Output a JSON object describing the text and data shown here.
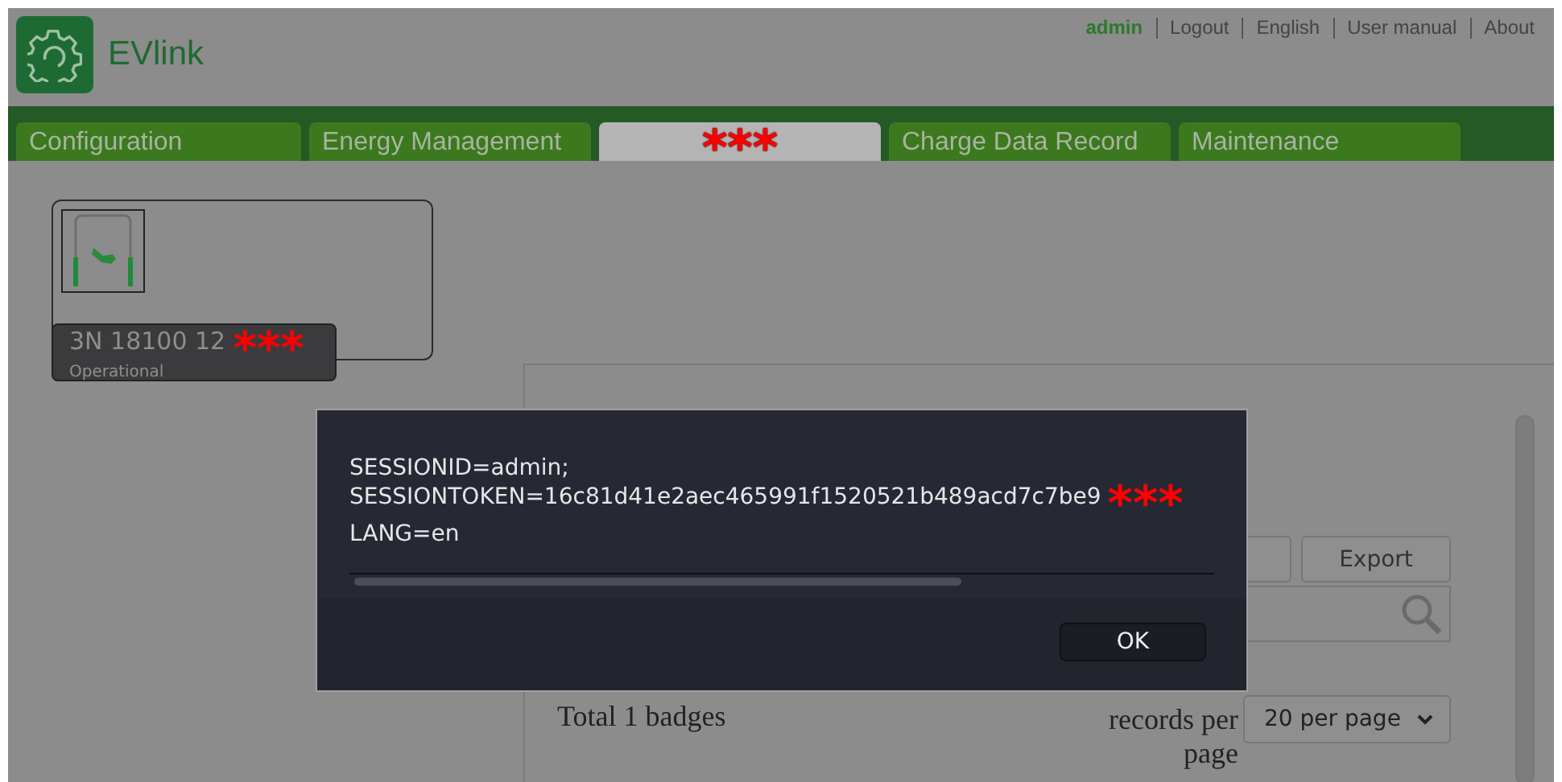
{
  "header": {
    "logo_text": "EVlink",
    "user": "admin",
    "links": [
      "Logout",
      "English",
      "User manual",
      "About"
    ]
  },
  "tabs": [
    {
      "label": "Configuration",
      "selected": false
    },
    {
      "label": "Energy Management",
      "selected": false
    },
    {
      "label": "***",
      "selected": true
    },
    {
      "label": "Charge Data Record",
      "selected": false
    },
    {
      "label": "Maintenance",
      "selected": false
    }
  ],
  "station": {
    "name": "3N 18100 12",
    "redaction": "***",
    "status": "Operational"
  },
  "badges_panel": {
    "export_button": "Export",
    "total": "Total 1 badges",
    "page_size_label": "records per page",
    "page_size": "20 per page"
  },
  "dialog": {
    "lines": [
      "SESSIONID=admin;",
      "SESSIONTOKEN=16c81d41e2aec465991f1520521b489acd7c7be9",
      "LANG=en"
    ],
    "redaction": "***",
    "button": "OK"
  }
}
